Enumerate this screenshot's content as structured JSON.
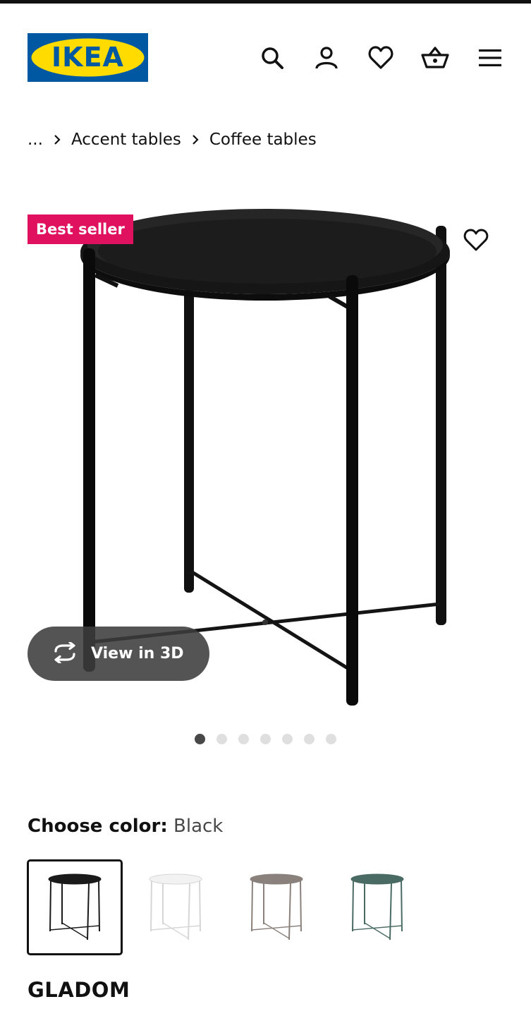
{
  "header": {
    "logo_text": "IKEA",
    "icons": [
      "search-icon",
      "user-icon",
      "heart-icon",
      "basket-icon",
      "menu-icon"
    ]
  },
  "breadcrumb": {
    "ellipsis": "...",
    "items": [
      "Accent tables",
      "Coffee tables"
    ]
  },
  "product": {
    "badge": "Best seller",
    "view_3d_label": "View in 3D",
    "carousel": {
      "count": 7,
      "active_index": 0
    },
    "name": "GLADOM"
  },
  "color_picker": {
    "label": "Choose color:",
    "selected": "Black",
    "swatches": [
      {
        "color": "#1a1a1a"
      },
      {
        "color": "#f2f2f2"
      },
      {
        "color": "#8a817c"
      },
      {
        "color": "#4a6b63"
      }
    ]
  },
  "colors": {
    "ikea_blue": "#0058a3",
    "ikea_yellow": "#ffdb00",
    "badge_red": "#e0115f",
    "text": "#111111"
  }
}
